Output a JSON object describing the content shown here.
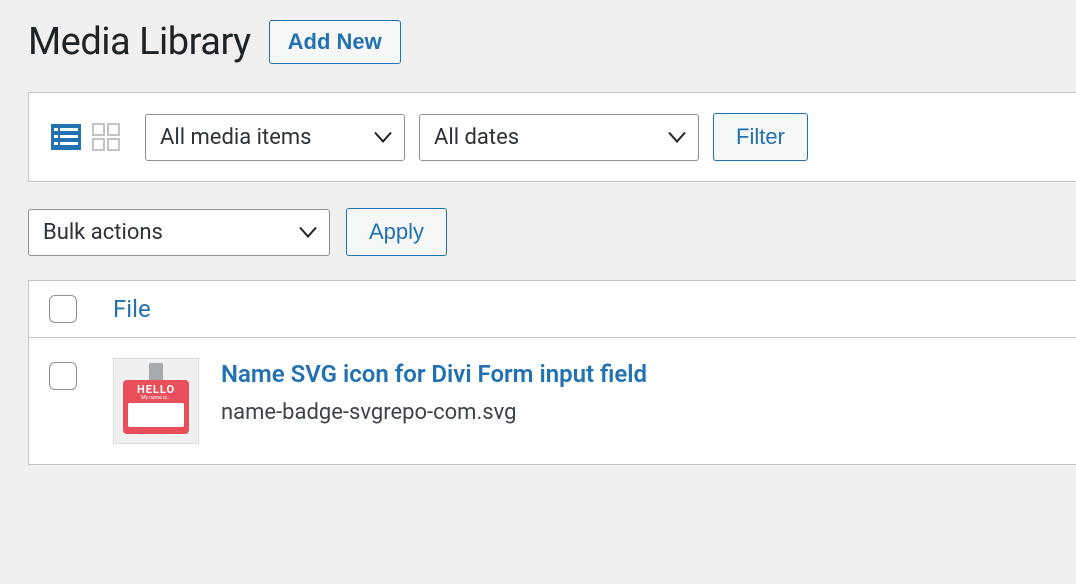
{
  "header": {
    "title": "Media Library",
    "add_new_label": "Add New"
  },
  "filters": {
    "media_type_selected": "All media items",
    "date_selected": "All dates",
    "filter_button_label": "Filter"
  },
  "bulk": {
    "selected": "Bulk actions",
    "apply_label": "Apply"
  },
  "table": {
    "columns": {
      "file": "File"
    },
    "rows": [
      {
        "title": "Name SVG icon for Divi Form input field",
        "filename": "name-badge-svgrepo-com.svg",
        "thumb": {
          "hello": "HELLO",
          "sub": "My name is..."
        }
      }
    ]
  }
}
